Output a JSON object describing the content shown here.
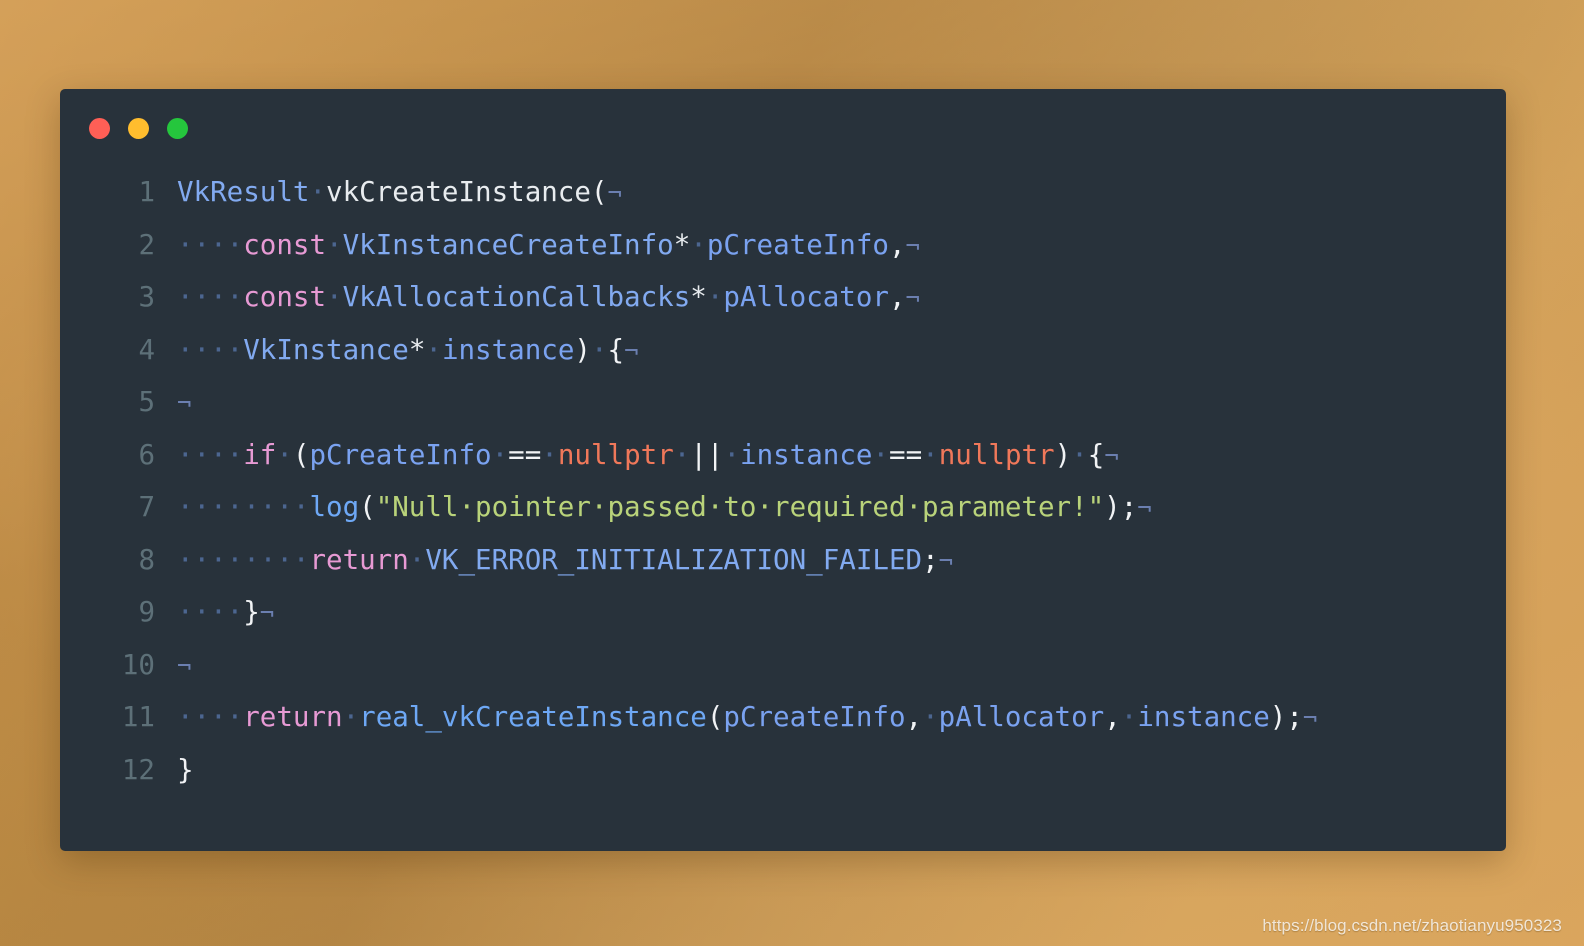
{
  "window": {
    "name": "code-snippet-window",
    "background_color": "#28323b",
    "traffic_lights": [
      {
        "name": "close-button",
        "color": "#ff5f56"
      },
      {
        "name": "minimize-button",
        "color": "#ffbd2e"
      },
      {
        "name": "maximize-button",
        "color": "#25c63d"
      }
    ]
  },
  "theme": {
    "page_background_start": "#d9a85f",
    "page_background_end": "#a87c3c",
    "gutter_color": "#5d7078",
    "plain": "#e8ecef",
    "type": "#82aaf0",
    "keyword": "#e79ad4",
    "function": "#6ea8f5",
    "variable": "#7aa2f0",
    "constant": "#f0785a",
    "string": "#b9d37a",
    "whitespace_dot": "#4c6690",
    "newline_marker": "#6b7fb0"
  },
  "code": {
    "language": "cpp",
    "newline_glyph": "¬",
    "space_glyph": "·",
    "plain_text": "VkResult vkCreateInstance(\n    const VkInstanceCreateInfo* pCreateInfo,\n    const VkAllocationCallbacks* pAllocator,\n    VkInstance* instance) {\n\n    if (pCreateInfo == nullptr || instance == nullptr) {\n        log(\"Null pointer passed to required parameter!\");\n        return VK_ERROR_INITIALIZATION_FAILED;\n    }\n\n    return real_vkCreateInstance(pCreateInfo, pAllocator, instance);\n}",
    "lines": [
      {
        "number": "1",
        "tokens": [
          {
            "cls": "t-type",
            "text": "VkResult"
          },
          {
            "cls": "dotsp",
            "text": "·"
          },
          {
            "cls": "t-plain",
            "text": "vkCreateInstance"
          },
          {
            "cls": "t-punc",
            "text": "("
          },
          {
            "cls": "nl",
            "text": "¬"
          }
        ]
      },
      {
        "number": "2",
        "tokens": [
          {
            "cls": "dotsp",
            "text": "····"
          },
          {
            "cls": "t-kw",
            "text": "const"
          },
          {
            "cls": "dotsp",
            "text": "·"
          },
          {
            "cls": "t-type",
            "text": "VkInstanceCreateInfo"
          },
          {
            "cls": "t-plain",
            "text": "*"
          },
          {
            "cls": "dotsp",
            "text": "·"
          },
          {
            "cls": "t-var",
            "text": "pCreateInfo"
          },
          {
            "cls": "t-punc",
            "text": ","
          },
          {
            "cls": "nl",
            "text": "¬"
          }
        ]
      },
      {
        "number": "3",
        "tokens": [
          {
            "cls": "dotsp",
            "text": "····"
          },
          {
            "cls": "t-kw",
            "text": "const"
          },
          {
            "cls": "dotsp",
            "text": "·"
          },
          {
            "cls": "t-type",
            "text": "VkAllocationCallbacks"
          },
          {
            "cls": "t-plain",
            "text": "*"
          },
          {
            "cls": "dotsp",
            "text": "·"
          },
          {
            "cls": "t-var",
            "text": "pAllocator"
          },
          {
            "cls": "t-punc",
            "text": ","
          },
          {
            "cls": "nl",
            "text": "¬"
          }
        ]
      },
      {
        "number": "4",
        "tokens": [
          {
            "cls": "dotsp",
            "text": "····"
          },
          {
            "cls": "t-type",
            "text": "VkInstance"
          },
          {
            "cls": "t-plain",
            "text": "*"
          },
          {
            "cls": "dotsp",
            "text": "·"
          },
          {
            "cls": "t-var",
            "text": "instance"
          },
          {
            "cls": "t-punc",
            "text": ")"
          },
          {
            "cls": "dotsp",
            "text": "·"
          },
          {
            "cls": "t-punc",
            "text": "{"
          },
          {
            "cls": "nl",
            "text": "¬"
          }
        ]
      },
      {
        "number": "5",
        "tokens": [
          {
            "cls": "nl",
            "text": "¬"
          }
        ]
      },
      {
        "number": "6",
        "tokens": [
          {
            "cls": "dotsp",
            "text": "····"
          },
          {
            "cls": "t-kw",
            "text": "if"
          },
          {
            "cls": "dotsp",
            "text": "·"
          },
          {
            "cls": "t-punc",
            "text": "("
          },
          {
            "cls": "t-var",
            "text": "pCreateInfo"
          },
          {
            "cls": "dotsp",
            "text": "·"
          },
          {
            "cls": "t-op",
            "text": "=="
          },
          {
            "cls": "dotsp",
            "text": "·"
          },
          {
            "cls": "t-const",
            "text": "nullptr"
          },
          {
            "cls": "dotsp",
            "text": "·"
          },
          {
            "cls": "t-op",
            "text": "||"
          },
          {
            "cls": "dotsp",
            "text": "·"
          },
          {
            "cls": "t-var",
            "text": "instance"
          },
          {
            "cls": "dotsp",
            "text": "·"
          },
          {
            "cls": "t-op",
            "text": "=="
          },
          {
            "cls": "dotsp",
            "text": "·"
          },
          {
            "cls": "t-const",
            "text": "nullptr"
          },
          {
            "cls": "t-punc",
            "text": ")"
          },
          {
            "cls": "dotsp",
            "text": "·"
          },
          {
            "cls": "t-punc",
            "text": "{"
          },
          {
            "cls": "nl",
            "text": "¬"
          }
        ]
      },
      {
        "number": "7",
        "tokens": [
          {
            "cls": "dotsp",
            "text": "········"
          },
          {
            "cls": "t-fn",
            "text": "log"
          },
          {
            "cls": "t-punc",
            "text": "("
          },
          {
            "cls": "t-str",
            "text": "\"Null·pointer·passed·to·required·parameter!\""
          },
          {
            "cls": "t-punc",
            "text": ");"
          },
          {
            "cls": "nl",
            "text": "¬"
          }
        ]
      },
      {
        "number": "8",
        "tokens": [
          {
            "cls": "dotsp",
            "text": "········"
          },
          {
            "cls": "t-kw",
            "text": "return"
          },
          {
            "cls": "dotsp",
            "text": "·"
          },
          {
            "cls": "t-type",
            "text": "VK_ERROR_INITIALIZATION_FAILED"
          },
          {
            "cls": "t-punc",
            "text": ";"
          },
          {
            "cls": "nl",
            "text": "¬"
          }
        ]
      },
      {
        "number": "9",
        "tokens": [
          {
            "cls": "dotsp",
            "text": "····"
          },
          {
            "cls": "t-punc",
            "text": "}"
          },
          {
            "cls": "nl",
            "text": "¬"
          }
        ]
      },
      {
        "number": "10",
        "tokens": [
          {
            "cls": "nl",
            "text": "¬"
          }
        ]
      },
      {
        "number": "11",
        "tokens": [
          {
            "cls": "dotsp",
            "text": "····"
          },
          {
            "cls": "t-kw",
            "text": "return"
          },
          {
            "cls": "dotsp",
            "text": "·"
          },
          {
            "cls": "t-fn",
            "text": "real_vkCreateInstance"
          },
          {
            "cls": "t-punc",
            "text": "("
          },
          {
            "cls": "t-var",
            "text": "pCreateInfo"
          },
          {
            "cls": "t-punc",
            "text": ","
          },
          {
            "cls": "dotsp",
            "text": "·"
          },
          {
            "cls": "t-var",
            "text": "pAllocator"
          },
          {
            "cls": "t-punc",
            "text": ","
          },
          {
            "cls": "dotsp",
            "text": "·"
          },
          {
            "cls": "t-var",
            "text": "instance"
          },
          {
            "cls": "t-punc",
            "text": ");"
          },
          {
            "cls": "nl",
            "text": "¬"
          }
        ]
      },
      {
        "number": "12",
        "tokens": [
          {
            "cls": "t-punc",
            "text": "}"
          }
        ]
      }
    ]
  },
  "watermark": {
    "text": "https://blog.csdn.net/zhaotianyu950323"
  }
}
